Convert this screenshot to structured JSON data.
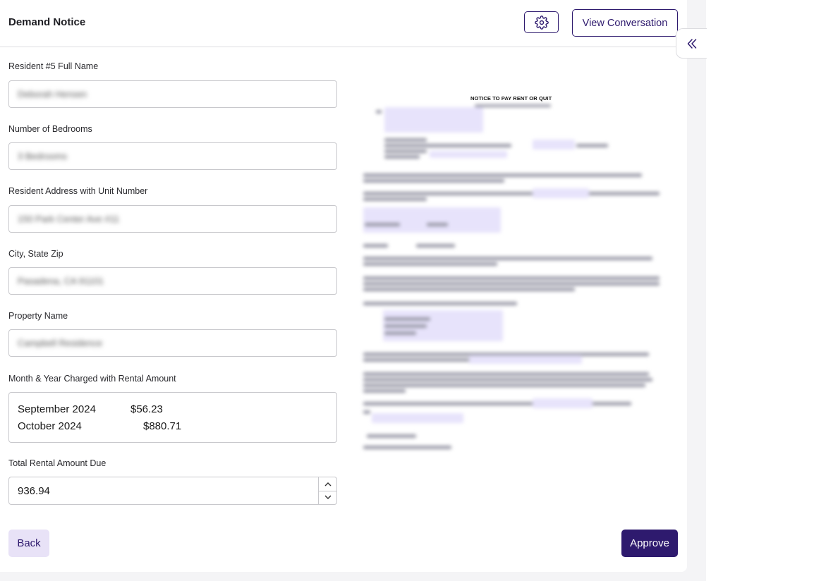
{
  "header": {
    "title": "Demand Notice",
    "view_conversation_label": "View Conversation"
  },
  "form": {
    "fields": [
      {
        "label": "Resident #5 Full Name",
        "value": "Deborah Hensen"
      },
      {
        "label": "Number of Bedrooms",
        "value": "3 Bedrooms"
      },
      {
        "label": "Resident Address with Unit Number",
        "value": "150 Park Center Ave #11"
      },
      {
        "label": "City, State Zip",
        "value": "Pasadena, CA 91101"
      },
      {
        "label": "Property Name",
        "value": "Campbell Residence"
      }
    ],
    "charges": {
      "label": "Month & Year Charged with Rental Amount",
      "lines": [
        {
          "month": "September 2024",
          "amount": "$56.23"
        },
        {
          "month": "October 2024",
          "amount": "$880.71"
        }
      ]
    },
    "total": {
      "label": "Total Rental Amount Due",
      "value": "936.94"
    }
  },
  "footer": {
    "back_label": "Back",
    "approve_label": "Approve"
  },
  "preview": {
    "doc_title": "NOTICE TO PAY RENT OR QUIT"
  },
  "icons": {
    "settings": "gear-icon",
    "collapse": "chevrons-left-icon",
    "increment": "chevron-up-icon",
    "decrement": "chevron-down-icon"
  },
  "colors": {
    "brand": "#2e1a6e",
    "back_button_bg": "#e8e2f7",
    "highlight": "#e7e3fb"
  }
}
